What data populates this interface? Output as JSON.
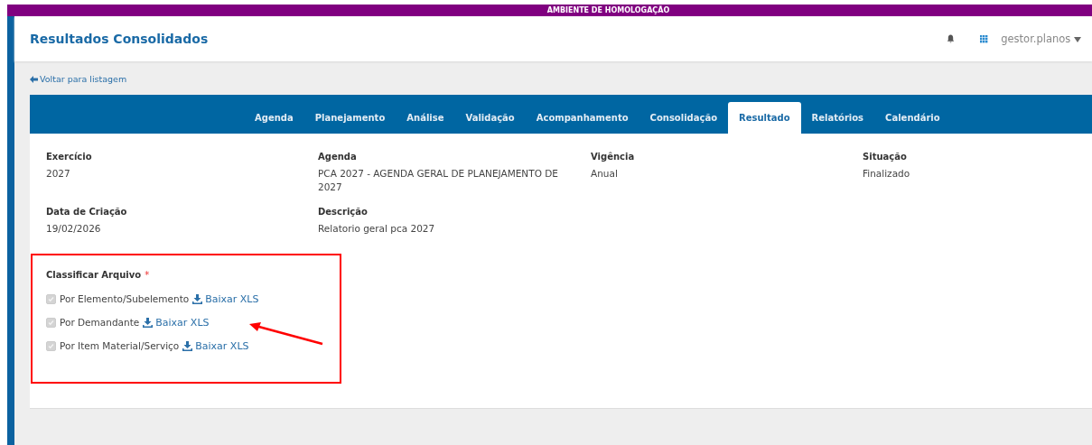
{
  "banner": {
    "text": "AMBIENTE DE HOMOLOGAÇÃO"
  },
  "header": {
    "title": "Resultados Consolidados",
    "user": "gestor.planos"
  },
  "back_link": "Voltar para listagem",
  "tabs": [
    {
      "label": "Agenda",
      "selected": false
    },
    {
      "label": "Planejamento",
      "selected": false
    },
    {
      "label": "Análise",
      "selected": false
    },
    {
      "label": "Validação",
      "selected": false
    },
    {
      "label": "Acompanhamento",
      "selected": false
    },
    {
      "label": "Consolidação",
      "selected": false
    },
    {
      "label": "Resultado",
      "selected": true
    },
    {
      "label": "Relatórios",
      "selected": false
    },
    {
      "label": "Calendário",
      "selected": false
    }
  ],
  "fields": [
    {
      "label": "Exercício",
      "value": "2027"
    },
    {
      "label": "Agenda",
      "value": "PCA 2027 - AGENDA GERAL DE PLANEJAMENTO DE 2027"
    },
    {
      "label": "Vigência",
      "value": "Anual"
    },
    {
      "label": "Situação",
      "value": "Finalizado"
    },
    {
      "label": "Data de Criação",
      "value": "19/02/2026"
    },
    {
      "label": "Descrição",
      "value": "Relatorio geral pca 2027"
    }
  ],
  "classify": {
    "label": "Classificar Arquivo",
    "required": "*",
    "options": [
      {
        "label": "Por Elemento/Subelemento",
        "checked": true,
        "disabled": true,
        "link": "Baixar XLS"
      },
      {
        "label": "Por Demandante",
        "checked": true,
        "disabled": true,
        "link": "Baixar XLS"
      },
      {
        "label": "Por Item Material/Serviço",
        "checked": true,
        "disabled": true,
        "link": "Baixar XLS"
      }
    ]
  }
}
